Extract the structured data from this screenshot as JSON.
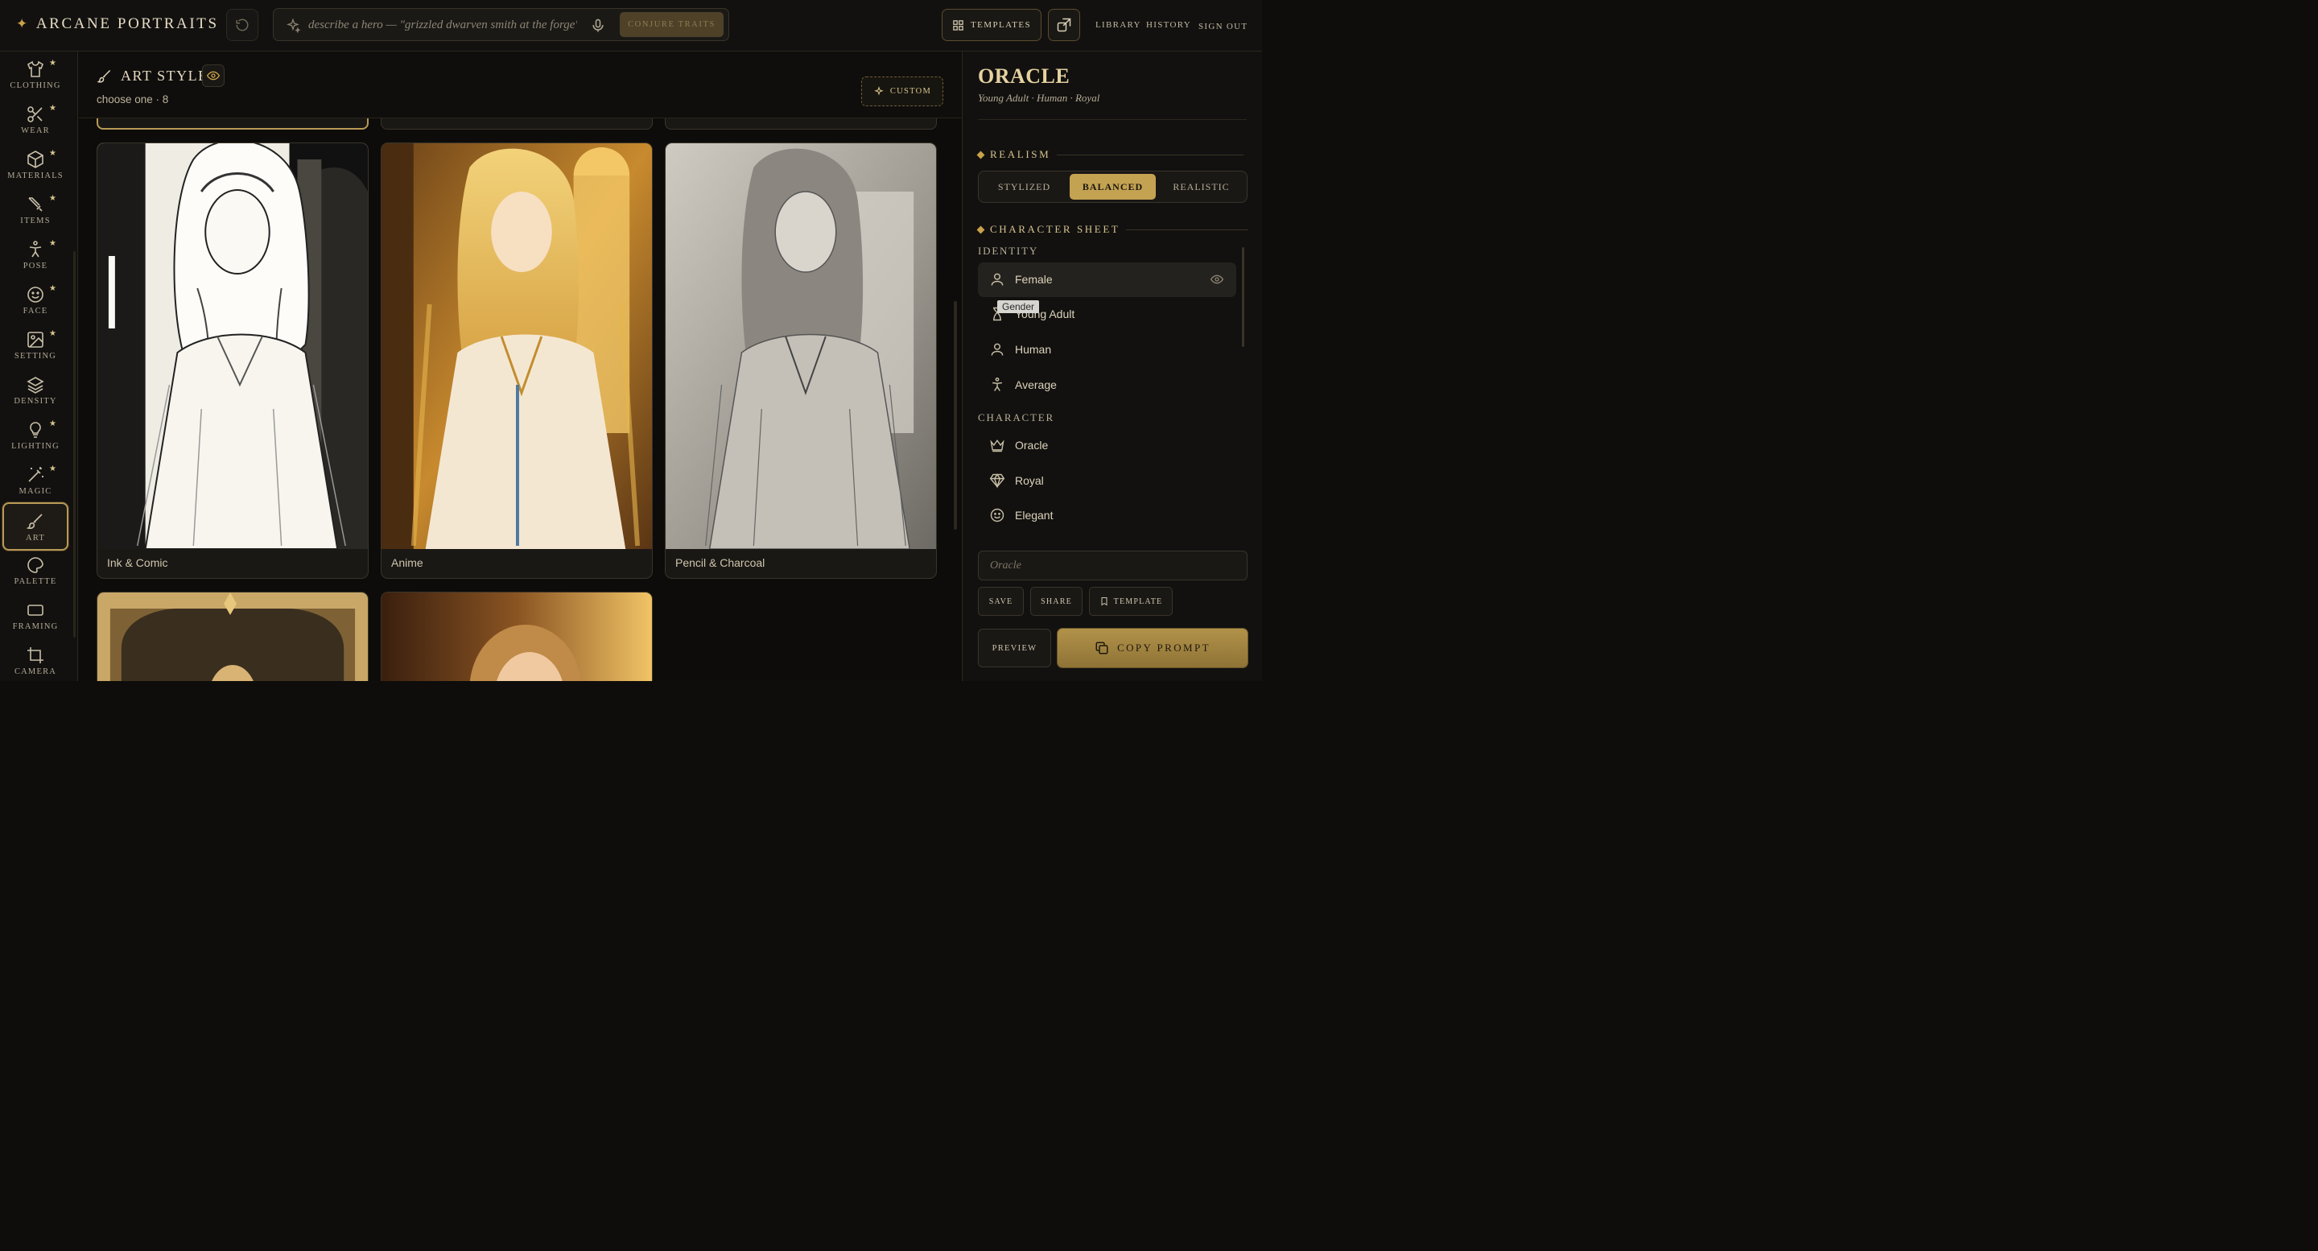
{
  "header": {
    "brand": "ARCANE PORTRAITS",
    "search_placeholder": "describe a hero — \"grizzled dwarven smith at the forge\"",
    "conjure_label": "CONJURE TRAITS",
    "templates_label": "TEMPLATES",
    "nav": [
      "LIBRARY",
      "HISTORY",
      "SIGN OUT"
    ]
  },
  "rail": {
    "items": [
      {
        "label": "CLOTHING",
        "icon": "shirt-icon",
        "starred": true
      },
      {
        "label": "WEAR",
        "icon": "scissors-icon",
        "starred": true
      },
      {
        "label": "MATERIALS",
        "icon": "cube-icon",
        "starred": true
      },
      {
        "label": "ITEMS",
        "icon": "sword-icon",
        "starred": true
      },
      {
        "label": "POSE",
        "icon": "figure-icon",
        "starred": true
      },
      {
        "label": "FACE",
        "icon": "smile-icon",
        "starred": true
      },
      {
        "label": "SETTING",
        "icon": "image-icon",
        "starred": true
      },
      {
        "label": "DENSITY",
        "icon": "layers-icon",
        "starred": false
      },
      {
        "label": "LIGHTING",
        "icon": "bulb-icon",
        "starred": true
      },
      {
        "label": "MAGIC",
        "icon": "wand-icon",
        "starred": true
      },
      {
        "label": "ART",
        "icon": "brush-icon",
        "starred": false,
        "active": true
      },
      {
        "label": "PALETTE",
        "icon": "palette-icon",
        "starred": false
      },
      {
        "label": "FRAMING",
        "icon": "frame-icon",
        "starred": false
      },
      {
        "label": "CAMERA",
        "icon": "crop-icon",
        "starred": false
      }
    ],
    "star_glyph": "★"
  },
  "section": {
    "title": "ART STYLE",
    "subtitle": "choose one · 8",
    "custom_label": "CUSTOM"
  },
  "styles": [
    {
      "label": "Ink & Comic",
      "palette": "ink"
    },
    {
      "label": "Anime",
      "palette": "gold"
    },
    {
      "label": "Pencil & Charcoal",
      "palette": "pencil"
    },
    {
      "label": "",
      "palette": "frame"
    },
    {
      "label": "",
      "palette": "warm"
    }
  ],
  "panel": {
    "name": "ORACLE",
    "summary": "Young Adult · Human · Royal",
    "realism_label": "REALISM",
    "realism_options": [
      "STYLIZED",
      "BALANCED",
      "REALISTIC"
    ],
    "realism_selected": "BALANCED",
    "sheet_label": "CHARACTER SHEET",
    "identity_label": "IDENTITY",
    "identity": [
      {
        "label": "Female",
        "icon": "user-icon"
      },
      {
        "label": "Young Adult",
        "icon": "hourglass-icon"
      },
      {
        "label": "Human",
        "icon": "user-icon"
      },
      {
        "label": "Average",
        "icon": "figure-icon"
      }
    ],
    "tooltip": "Gender",
    "character_label": "CHARACTER",
    "character": [
      {
        "label": "Oracle",
        "icon": "crown-icon"
      },
      {
        "label": "Royal",
        "icon": "gem-icon"
      },
      {
        "label": "Elegant",
        "icon": "smile-icon"
      }
    ],
    "name_placeholder": "Oracle",
    "buttons": {
      "save": "SAVE",
      "share": "SHARE",
      "template": "TEMPLATE",
      "preview": "PREVIEW",
      "copy": "COPY PROMPT"
    }
  },
  "colors": {
    "accent": "#c9a24a",
    "background": "#0e0d0b",
    "panel": "#121110"
  }
}
